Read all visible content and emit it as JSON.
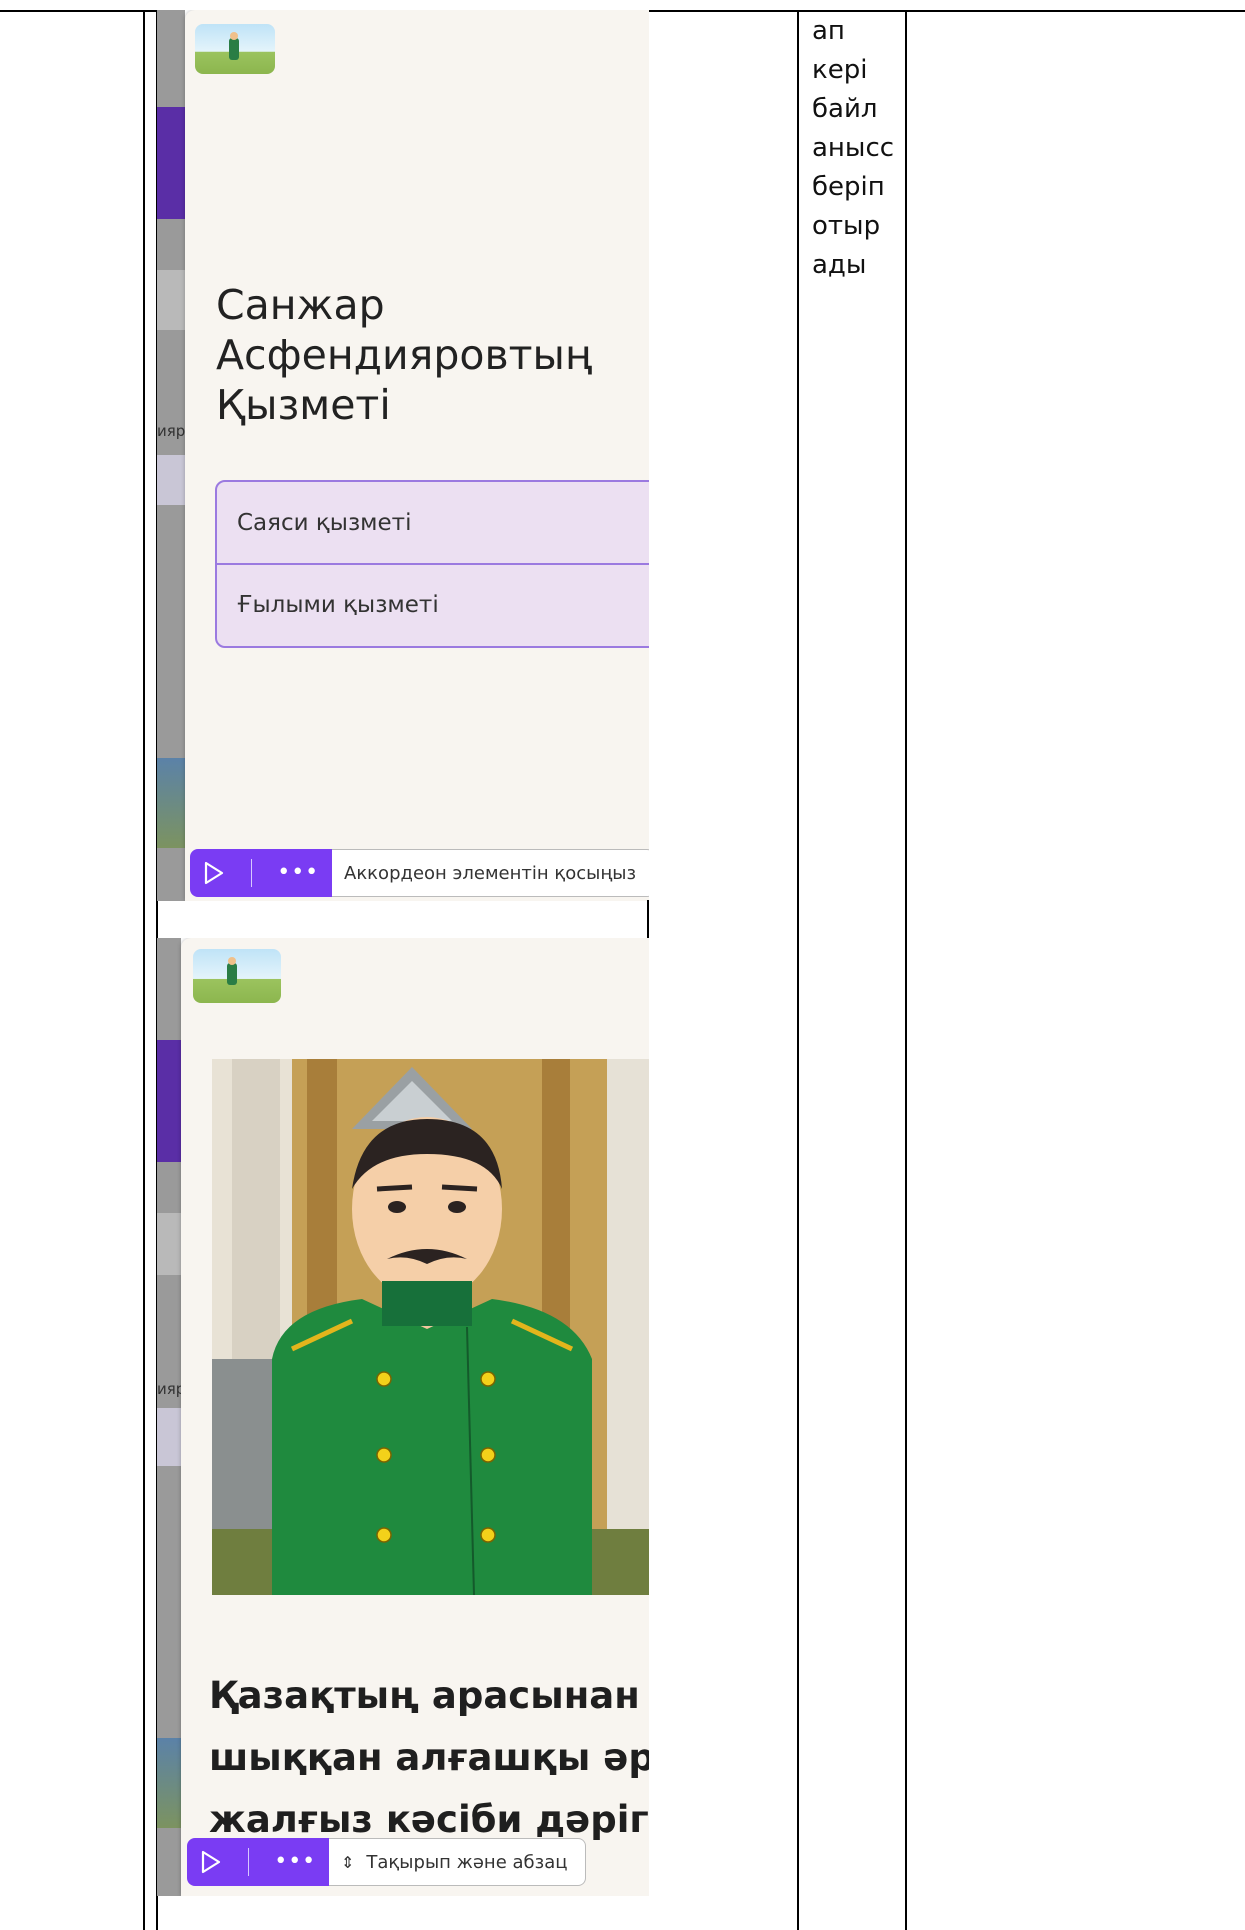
{
  "side_column": {
    "lines": [
      "ап",
      "кері",
      "байл",
      "анысс",
      "беріп",
      "отыр",
      "ады"
    ]
  },
  "screen1": {
    "title_lines": [
      "Санжар",
      "Асфендияровтың",
      "Қызметі"
    ],
    "accordion_items": [
      "Саяси қызметі",
      "Ғылыми қызметі"
    ],
    "toolbar_label": "Аккордеон элементін қосыңыз",
    "strip_text": "ияр"
  },
  "screen2": {
    "title_lines": [
      "Қазақтың арасынан",
      "шыққан алғашқы әрі",
      "жалғыз кәсіби дәрігер"
    ],
    "toolbar_label": "Тақырып және абзац",
    "strip_text": "ияр"
  },
  "colors": {
    "accent": "#7a3cf3",
    "accordion_bg": "#ece0f2",
    "accordion_border": "#9b7ae0",
    "card_bg": "#f8f5f0",
    "uniform_green": "#1f8a3e"
  }
}
